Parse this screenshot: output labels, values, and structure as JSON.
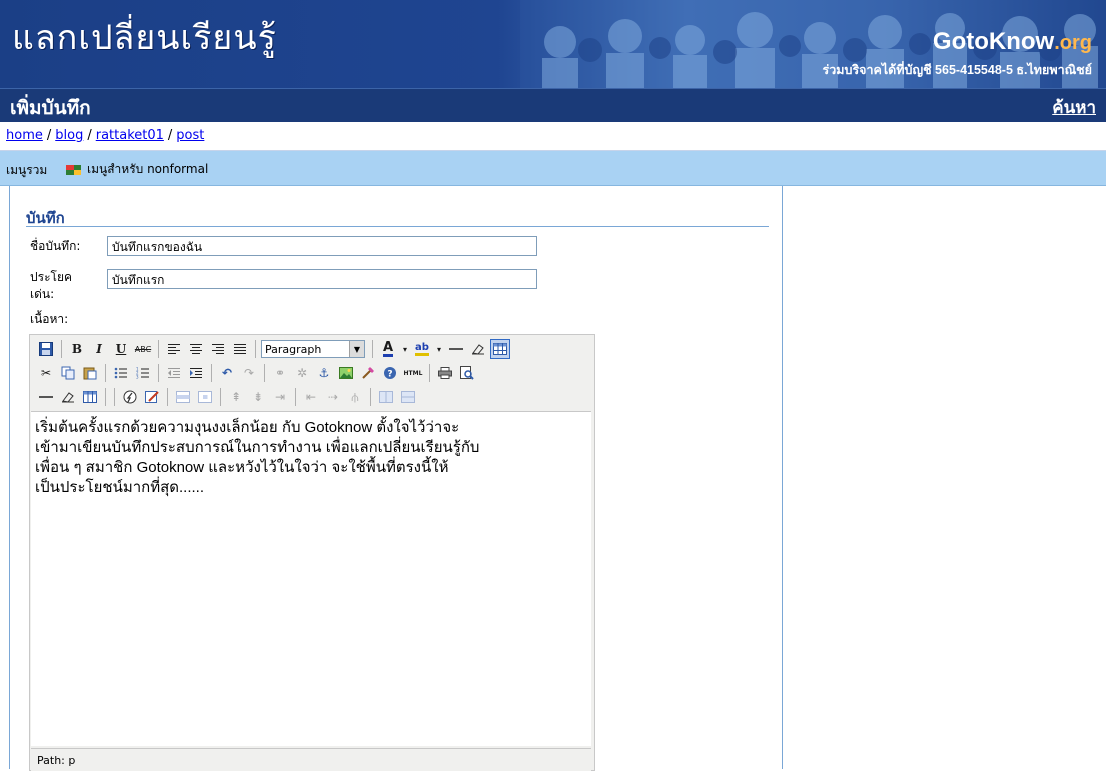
{
  "banner": {
    "site_title": "แลกเปลี่ยนเรียนรู้",
    "brand_a": "Goto",
    "brand_b": "Know",
    "brand_c": ".org",
    "donate_text": "ร่วมบริจาคได้ที่บัญชี 565-415548-5 ธ.ไทยพาณิชย์"
  },
  "titlebar": {
    "page_title": "เพิ่มบันทึก",
    "search_link": "ค้นหา"
  },
  "breadcrumb": {
    "items": [
      "home",
      "blog",
      "rattaket01",
      "post"
    ],
    "separator": "/"
  },
  "menu": {
    "main": "เมนูรวม",
    "nonformal": "เมนูสำหรับ nonformal"
  },
  "form": {
    "section_title": "บันทึก",
    "title_label": "ชื่อบันทึก:",
    "title_value": "บันทึกแรกของฉัน",
    "tagline_label_1": "ประโยค",
    "tagline_label_2": "เด่น:",
    "tagline_value": "บันทึกแรก",
    "body_label": "เนื้อหา:"
  },
  "editor": {
    "format_select": "Paragraph",
    "html_btn": "HTML",
    "content_lines": [
      "เริ่มต้นครั้งแรกด้วยความงุนงงเล็กน้อย กับ Gotoknow ตั้งใจไว้ว่าจะ",
      "เข้ามาเขียนบันทึกประสบการณ์ในการทำงาน เพื่อแลกเปลี่ยนเรียนรู้กับ",
      "เพื่อน ๆ สมาชิก Gotoknow และหวังไว้ในใจว่า จะใช้พื้นที่ตรงนี้ให้",
      "เป็นประโยชน์มากที่สุด......"
    ],
    "path_text": "Path: p"
  },
  "colors": {
    "banner": "#1b3f86",
    "titlebar": "#1a3a78",
    "menubar": "#a9d2f3",
    "section_title": "#1f4591"
  }
}
